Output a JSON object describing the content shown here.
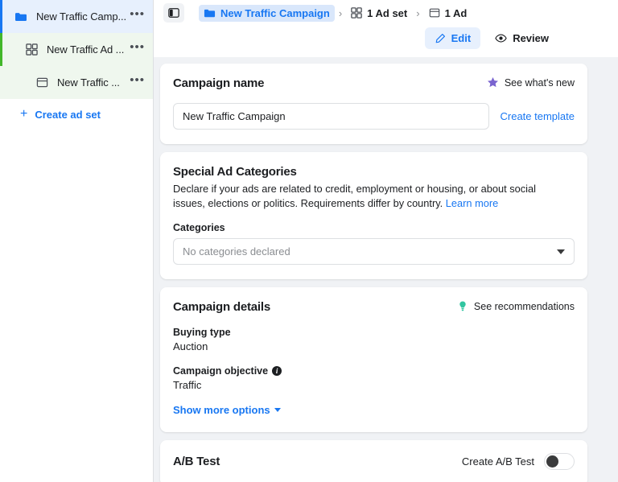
{
  "sidebar": {
    "items": [
      {
        "label": "New Traffic Camp...",
        "icon": "folder-icon",
        "menu": "•••",
        "level": 1,
        "type": "campaign"
      },
      {
        "label": "New Traffic Ad ...",
        "icon": "grid-icon",
        "menu": "•••",
        "level": 2,
        "type": "adset"
      },
      {
        "label": "New Traffic ...",
        "icon": "window-icon",
        "menu": "•••",
        "level": 3,
        "type": "ad"
      }
    ],
    "create_ad_set": "Create ad set",
    "plus": "+",
    "accent_campaign": "#1877f2",
    "accent_adset": "#42b72a"
  },
  "topbar": {
    "panel_toggle": "panel-toggle-icon",
    "breadcrumbs": [
      {
        "label": "New Traffic Campaign",
        "icon": "folder-icon",
        "active": true
      },
      {
        "label": "1 Ad set",
        "icon": "grid-icon",
        "active": false
      },
      {
        "label": "1 Ad",
        "icon": "window-icon",
        "active": false
      }
    ],
    "separator": "›",
    "edit_label": "Edit",
    "review_label": "Review"
  },
  "campaign_name_card": {
    "title": "Campaign name",
    "whats_new": "See what's new",
    "input_value": "New Traffic Campaign",
    "input_placeholder": "Campaign name",
    "create_template": "Create template"
  },
  "special_ad_categories": {
    "title": "Special Ad Categories",
    "description": "Declare if your ads are related to credit, employment or housing, or about social issues, elections or politics. Requirements differ by country. ",
    "learn_more": "Learn more",
    "categories_label": "Categories",
    "categories_value": "No categories declared"
  },
  "campaign_details": {
    "title": "Campaign details",
    "see_recommendations": "See recommendations",
    "buying_type_label": "Buying type",
    "buying_type_value": "Auction",
    "objective_label": "Campaign objective",
    "objective_info": "i",
    "objective_value": "Traffic",
    "show_more_options": "Show more options"
  },
  "ab_test": {
    "title": "A/B Test",
    "toggle_label": "Create A/B Test",
    "toggle_state": "off"
  },
  "colors": {
    "brand_blue": "#1877f2",
    "green": "#42b72a",
    "purple_star": "#7a64cf",
    "teal_bulb": "#31c5a0",
    "page_bg": "#f0f2f5"
  }
}
